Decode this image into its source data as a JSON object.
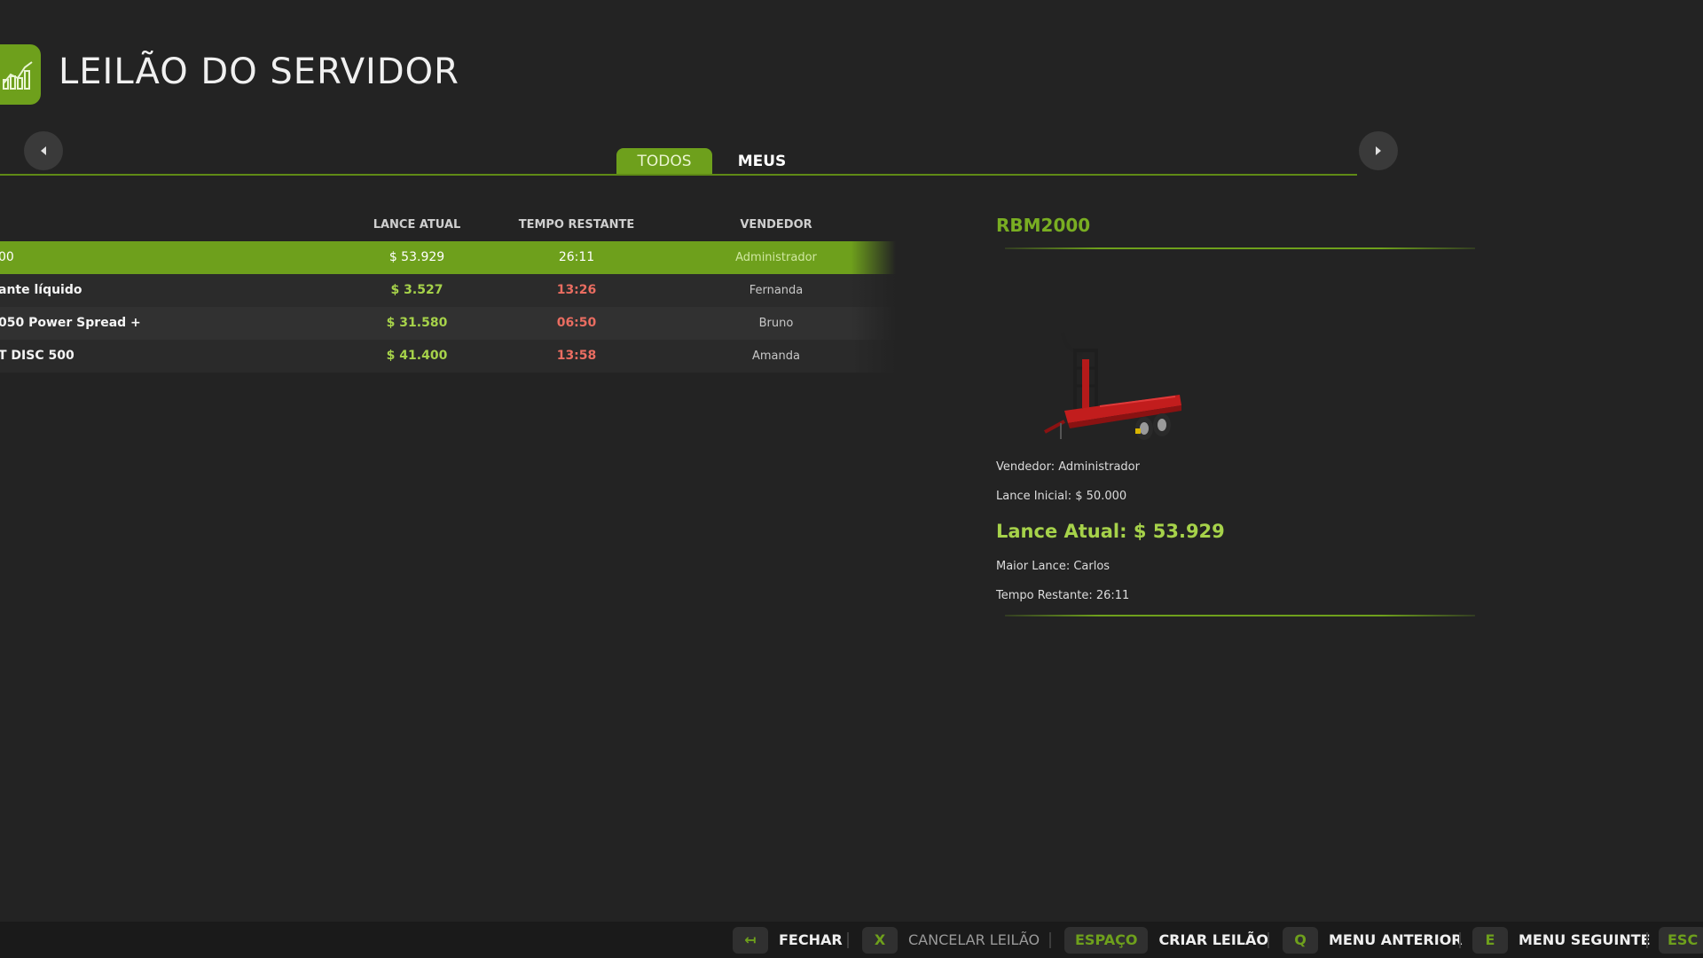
{
  "header": {
    "title": "LEILÃO DO SERVIDOR"
  },
  "tabs": [
    {
      "label": "TODOS",
      "active": true
    },
    {
      "label": "MEUS",
      "active": false
    }
  ],
  "table": {
    "columns": {
      "bid": "LANCE ATUAL",
      "time": "TEMPO RESTANTE",
      "seller": "VENDEDOR"
    },
    "rows": [
      {
        "name": "00",
        "bid": "$ 53.929",
        "time": "26:11",
        "seller": "Administrador",
        "selected": true
      },
      {
        "name": "ante líquido",
        "bid": "$ 3.527",
        "time": "13:26",
        "seller": "Fernanda"
      },
      {
        "name": "050 Power Spread +",
        "bid": "$ 31.580",
        "time": "06:50",
        "seller": "Bruno"
      },
      {
        "name": "T DISC 500",
        "bid": "$ 41.400",
        "time": "13:58",
        "seller": "Amanda"
      }
    ]
  },
  "detail": {
    "title": "RBM2000",
    "seller": "Vendedor: Administrador",
    "start_bid": "Lance Inicial: $ 50.000",
    "current_bid": "Lance Atual: $ 53.929",
    "highest_bidder": "Maior Lance: Carlos",
    "time_left": "Tempo Restante: 26:11"
  },
  "footer": {
    "close": {
      "key": "↤",
      "label": "FECHAR"
    },
    "cancel": {
      "key": "X",
      "label": "CANCELAR LEILÃO"
    },
    "create": {
      "key": "ESPAÇO",
      "label": "CRIAR LEILÃO"
    },
    "prev_menu": {
      "key": "Q",
      "label": "MENU ANTERIOR"
    },
    "next_menu": {
      "key": "E",
      "label": "MENU SEGUINTE"
    },
    "esc": {
      "key": "ESC"
    }
  },
  "colors": {
    "accent": "#6ea01c",
    "background": "#232323",
    "time_red": "#ea6d61",
    "bid_green": "#a6d24a"
  }
}
